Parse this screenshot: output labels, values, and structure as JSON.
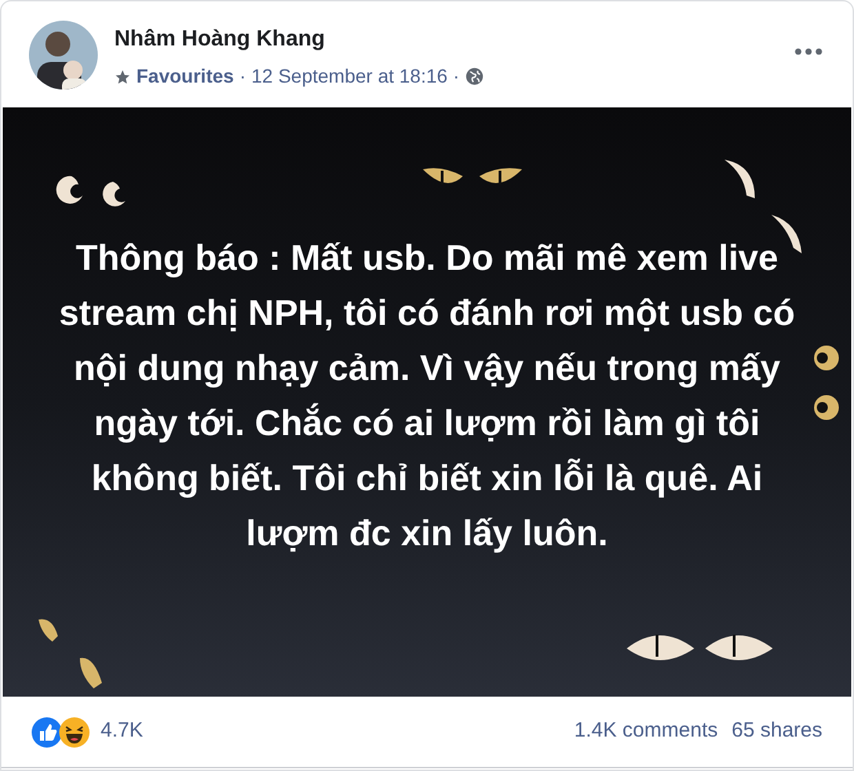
{
  "post": {
    "author": "Nhâm Hoàng Khang",
    "audience": "Favourites",
    "separator_1": "·",
    "timestamp": "12 September at 18:16",
    "separator_2": "·",
    "body": "Thông báo : Mất usb. Do mãi mê xem live stream chị NPH, tôi có đánh rơi một usb có nội dung nhạy cảm. Vì vậy nếu trong mấy ngày tới. Chắc có ai lượm rồi làm gì tôi không biết. Tôi chỉ biết xin lỗi là quê. Ai lượm đc xin lấy luôn."
  },
  "footer": {
    "reactions_count": "4.7K",
    "comments": "1.4K comments",
    "shares": "65 shares"
  }
}
